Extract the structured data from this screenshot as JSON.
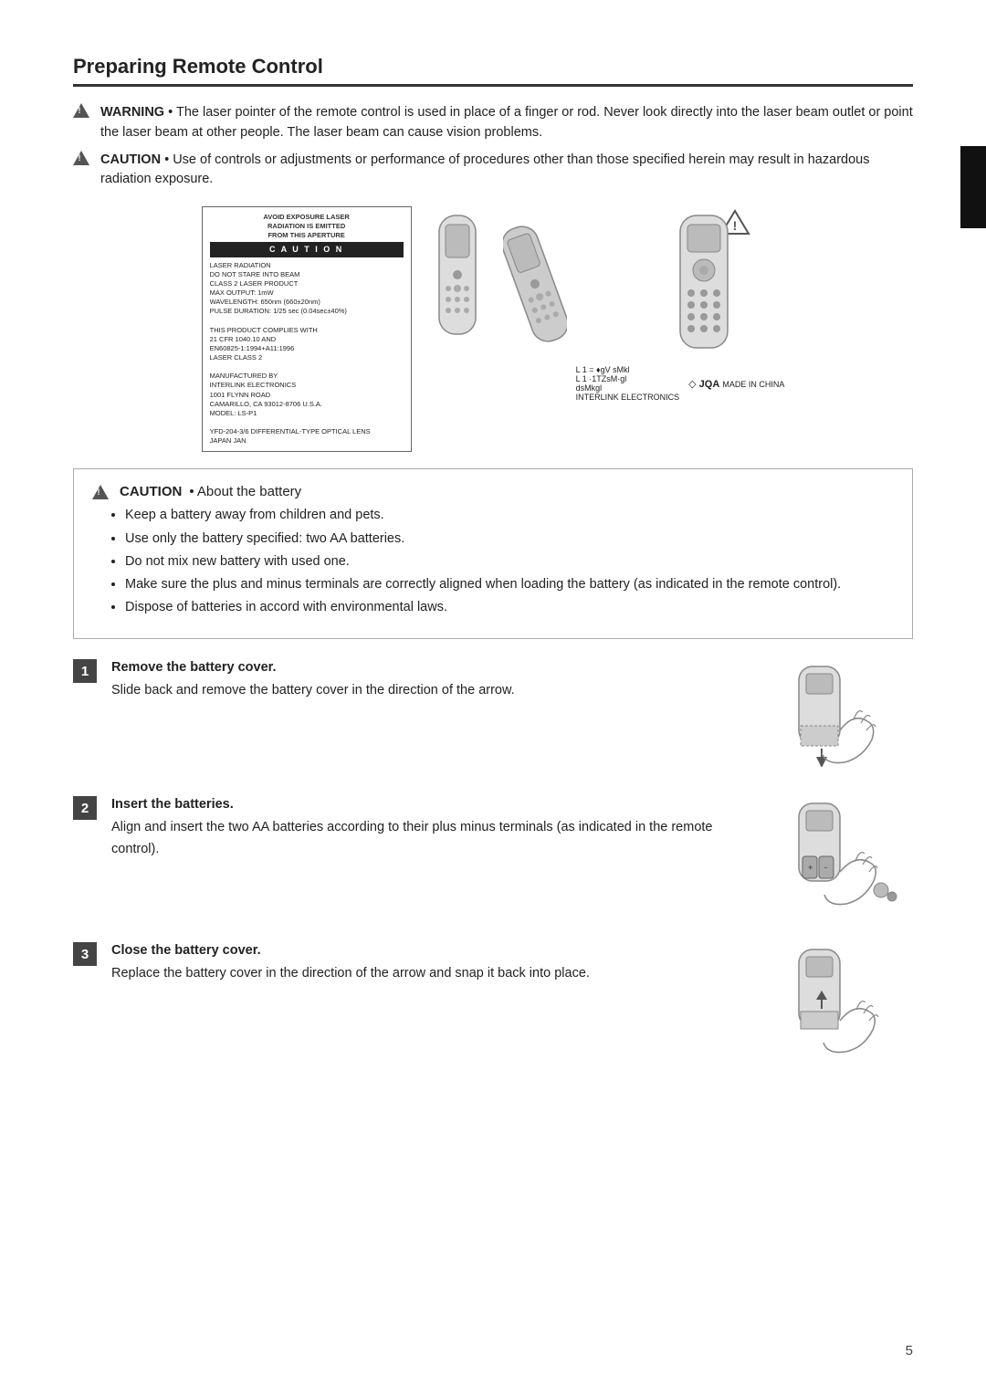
{
  "page": {
    "title": "Preparing Remote Control",
    "page_number": "5"
  },
  "warning": {
    "label": "WARNING",
    "text": "• The laser pointer of the remote control is used in place of a finger or rod. Never look directly into the laser beam outlet or point the laser beam at other people. The laser beam can cause vision problems."
  },
  "caution1": {
    "label": "CAUTION",
    "text": "• Use of controls or adjustments or performance of procedures other than those specified herein may result in hazardous radiation exposure."
  },
  "label_box": {
    "caution_bar": "C A U T I O N",
    "header": "AVOID EXPOSURE LASER RADIATION IS EMITTED FROM THIS APERTURE",
    "lines": [
      "LASER RADIATION",
      "DO NOT STARE INTO BEAM",
      "CLASS 2 LASER PRODUCT",
      "MAX OUTPUT: 1mW",
      "WAVELENGTH: 650nm (660±20nm)",
      "PULSE DURATION: 1/25 sec (0.04sec±40%)",
      "THIS PRODUCT COMPLIES WITH",
      "21 CFR 1040.10 AND",
      "EN60825-1:1994+A11:1996",
      "LASER CLASS 2",
      "MANUFACTURED BY",
      "INTERLINK ELECTRONICS",
      "1001 FLYNN ROAD",
      "CAMARILLO, CA 93012-8706 U.S.A.",
      "MODEL: LS-P1",
      "YFD-204-3/6 DIFFERENTIAL-TYPE OPTICAL LENS",
      "JAPAN JAN"
    ]
  },
  "caution2": {
    "label": "CAUTION",
    "about": "About the battery",
    "bullets": [
      "Keep a battery away from children and pets.",
      "Use only the battery specified: two AA batteries.",
      "Do not mix new battery with used one.",
      "Make sure the plus and minus terminals are correctly aligned when loading the battery (as indicated in the remote control).",
      "Dispose of batteries in accord with environmental laws."
    ]
  },
  "steps": [
    {
      "number": "1",
      "title": "Remove the battery cover.",
      "description": "Slide back and remove the battery cover in the direction of the arrow."
    },
    {
      "number": "2",
      "title": "Insert the batteries.",
      "description": "Align and insert the two AA batteries according to their plus minus terminals (as indicated in the remote control)."
    },
    {
      "number": "3",
      "title": "Close the battery cover.",
      "description": "Replace the battery cover in the direction of the arrow and snap it back into place."
    }
  ],
  "jqa": {
    "text": "JQA MADE IN CHINA"
  }
}
